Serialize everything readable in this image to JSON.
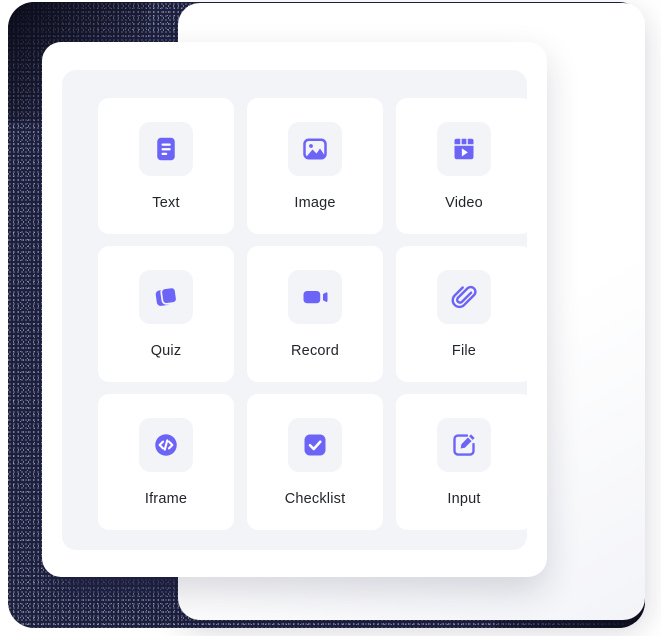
{
  "theme": {
    "accent": "#6c63f7",
    "backdrop": "#1e2040",
    "panel_bg": "#f3f4f8",
    "card_bg": "#ffffff",
    "label_color": "#22252c"
  },
  "content_picker": {
    "items": [
      {
        "label": "Text",
        "icon": "text-document-icon"
      },
      {
        "label": "Image",
        "icon": "image-picture-icon"
      },
      {
        "label": "Video",
        "icon": "video-play-icon"
      },
      {
        "label": "Quiz",
        "icon": "stacked-cards-icon"
      },
      {
        "label": "Record",
        "icon": "video-camera-icon"
      },
      {
        "label": "File",
        "icon": "paperclip-icon"
      },
      {
        "label": "Iframe",
        "icon": "code-brackets-icon"
      },
      {
        "label": "Checklist",
        "icon": "checkbox-check-icon"
      },
      {
        "label": "Input",
        "icon": "edit-pencil-square-icon"
      }
    ]
  }
}
